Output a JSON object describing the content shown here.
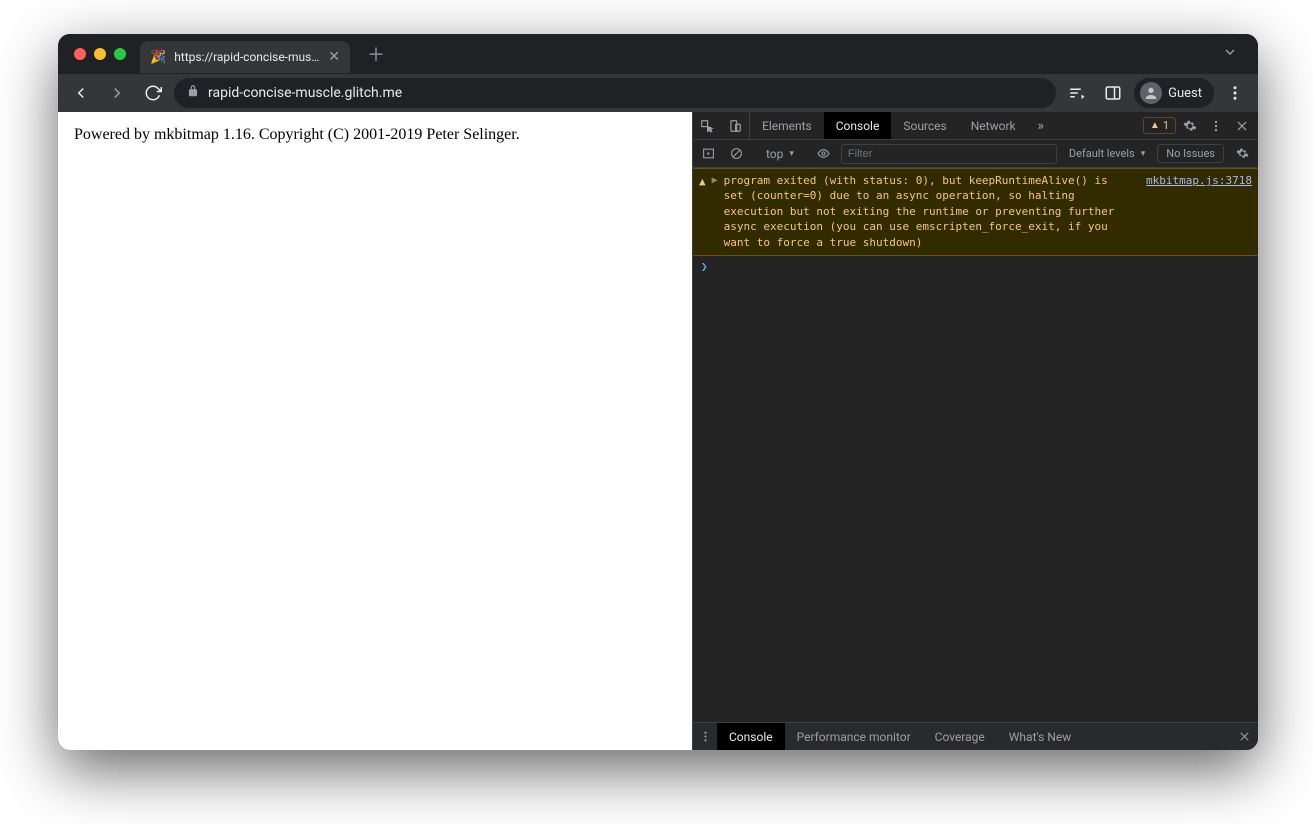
{
  "tab": {
    "title": "https://rapid-concise-muscle.g",
    "favicon": "🎉"
  },
  "toolbar": {
    "address": "rapid-concise-muscle.glitch.me",
    "profile_label": "Guest"
  },
  "page": {
    "body_text": "Powered by mkbitmap 1.16. Copyright (C) 2001-2019 Peter Selinger."
  },
  "devtools": {
    "tabs": {
      "elements": "Elements",
      "console": "Console",
      "sources": "Sources",
      "network": "Network"
    },
    "warning_count": "1",
    "console_toolbar": {
      "context": "top",
      "filter_placeholder": "Filter",
      "levels": "Default levels",
      "issues": "No Issues"
    },
    "log": {
      "message": "program exited (with status: 0), but keepRuntimeAlive() is set (counter=0) due to an async operation, so halting execution but not exiting the runtime or preventing further async execution (you can use emscripten_force_exit, if you want to force a true shutdown)",
      "source": "mkbitmap.js:3718"
    },
    "drawer": {
      "console": "Console",
      "perf": "Performance monitor",
      "coverage": "Coverage",
      "whatsnew": "What's New"
    }
  }
}
